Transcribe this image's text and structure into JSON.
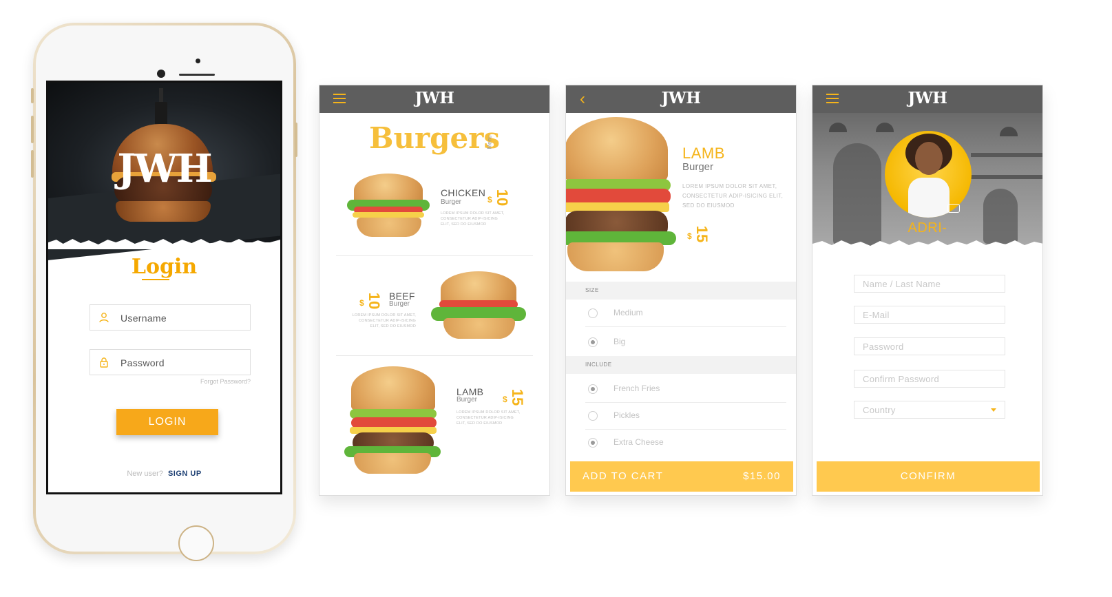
{
  "phone": {
    "hero_logo": "JWH",
    "title": "Login",
    "username_placeholder": "Username",
    "password_placeholder": "Password",
    "forgot_label": "Forgot Password?",
    "login_button": "LOGIN",
    "new_user_text": "New user?",
    "signup_label": "SIGN UP"
  },
  "brand": "JWH",
  "menu": {
    "title": "Burgers",
    "subtitle": "Menu",
    "items": [
      {
        "name": "CHICKEN",
        "type": "Burger",
        "currency": "$",
        "price": "10",
        "desc": "LOREM IPSUM DOLOR SIT AMET, CONSECTETUR ADIP-ISICING ELIT, SED DO EIUSMOD"
      },
      {
        "name": "BEEF",
        "type": "Burger",
        "currency": "$",
        "price": "10",
        "desc": "LOREM IPSUM DOLOR SIT AMET, CONSECTETUR ADIP-ISICING ELIT, SED DO EIUSMOD"
      },
      {
        "name": "LAMB",
        "type": "Burger",
        "currency": "$",
        "price": "15",
        "desc": "LOREM IPSUM DOLOR SIT AMET, CONSECTETUR ADIP-ISICING ELIT, SED DO EIUSMOD"
      }
    ]
  },
  "detail": {
    "name": "LAMB",
    "type": "Burger",
    "desc": "LOREM IPSUM DOLOR SIT AMET, CONSECTETUR ADIP-ISICING ELIT, SED DO EIUSMOD",
    "currency": "$",
    "price": "15",
    "size_header": "SIZE",
    "sizes": [
      {
        "label": "Medium",
        "selected": false
      },
      {
        "label": "Big",
        "selected": true
      }
    ],
    "include_header": "INCLUDE",
    "includes": [
      {
        "label": "French Fries",
        "selected": true
      },
      {
        "label": "Pickles",
        "selected": false
      },
      {
        "label": "Extra Cheese",
        "selected": true
      }
    ],
    "cta_label": "ADD TO CART",
    "cta_price": "$15.00"
  },
  "profile": {
    "name": "ADRI-",
    "fields": [
      "Name / Last Name",
      "E-Mail",
      "Password",
      "Confirm Password"
    ],
    "country_placeholder": "Country",
    "confirm_label": "CONFIRM"
  },
  "colors": {
    "accent": "#f5b41a",
    "cta": "#ffc94f",
    "topbar": "#5e5e5e",
    "link": "#1d3f73"
  }
}
